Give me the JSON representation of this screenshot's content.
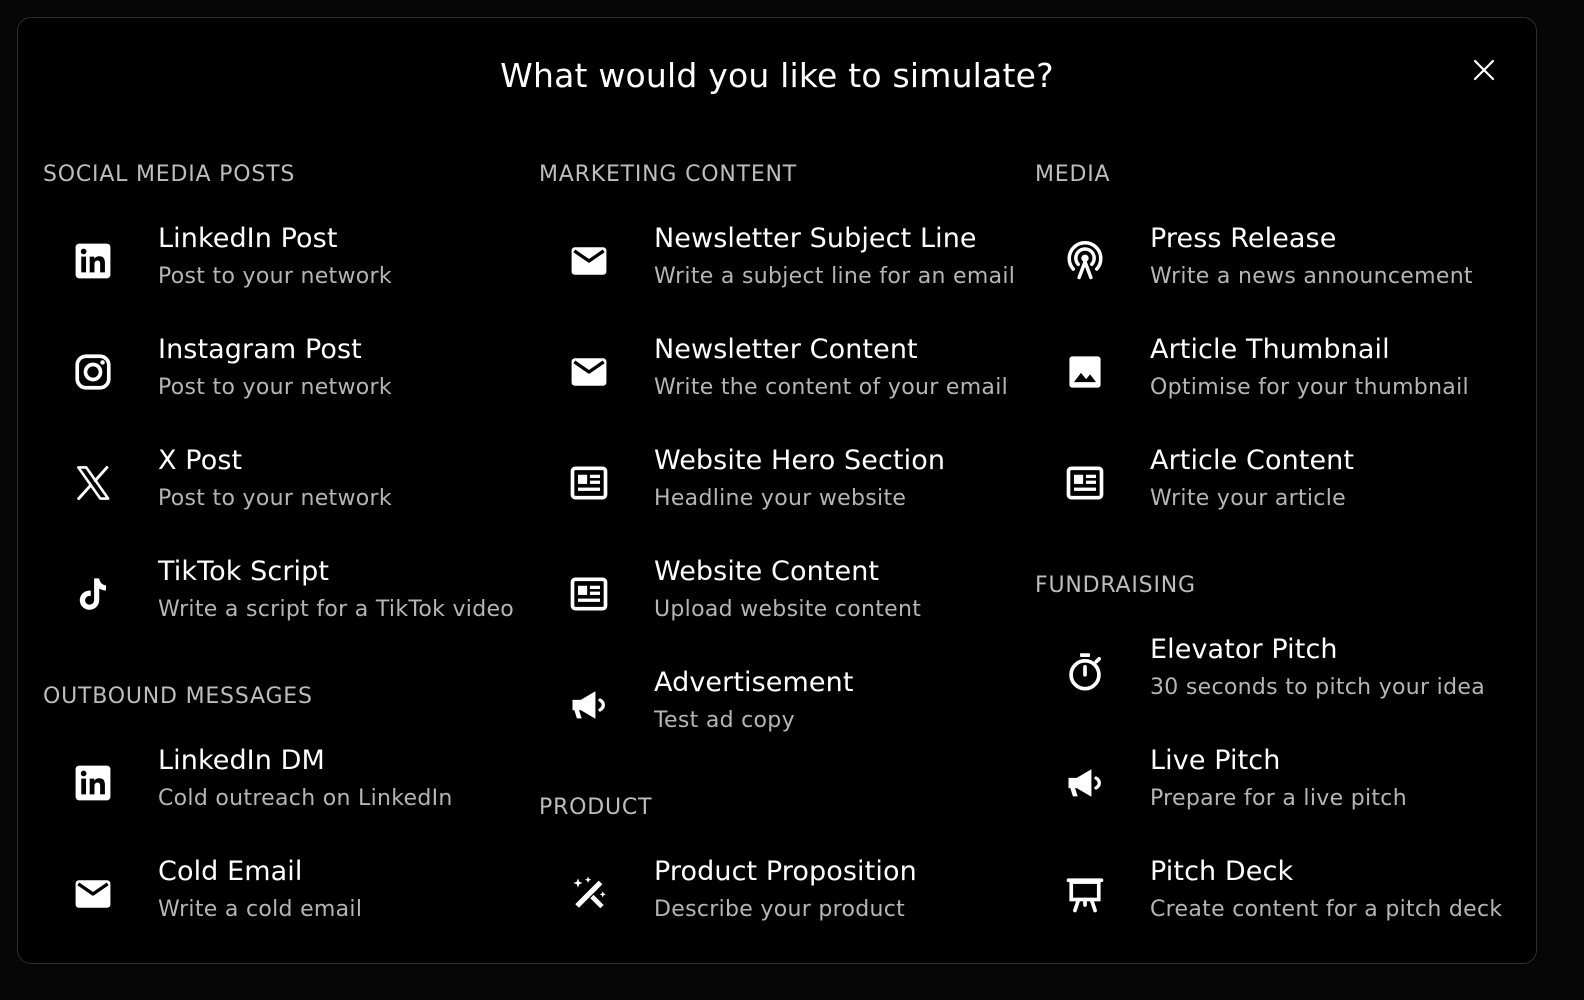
{
  "dialog": {
    "title": "What would you like to simulate?"
  },
  "sections": {
    "social": {
      "title": "SOCIAL MEDIA POSTS",
      "items": [
        {
          "label": "LinkedIn Post",
          "desc": "Post to your network",
          "icon": "linkedin-icon"
        },
        {
          "label": "Instagram Post",
          "desc": "Post to your network",
          "icon": "instagram-icon"
        },
        {
          "label": "X Post",
          "desc": "Post to your network",
          "icon": "x-icon"
        },
        {
          "label": "TikTok Script",
          "desc": "Write a script for a TikTok video",
          "icon": "tiktok-icon"
        }
      ]
    },
    "outbound": {
      "title": "OUTBOUND MESSAGES",
      "items": [
        {
          "label": "LinkedIn DM",
          "desc": "Cold outreach on LinkedIn",
          "icon": "linkedin-icon"
        },
        {
          "label": "Cold Email",
          "desc": "Write a cold email",
          "icon": "email-icon"
        }
      ]
    },
    "marketing": {
      "title": "MARKETING CONTENT",
      "items": [
        {
          "label": "Newsletter Subject Line",
          "desc": "Write a subject line for an email",
          "icon": "email-icon"
        },
        {
          "label": "Newsletter Content",
          "desc": "Write the content of your email",
          "icon": "email-icon"
        },
        {
          "label": "Website Hero Section",
          "desc": "Headline your website",
          "icon": "article-icon"
        },
        {
          "label": "Website Content",
          "desc": "Upload website content",
          "icon": "article-icon"
        },
        {
          "label": "Advertisement",
          "desc": "Test ad copy",
          "icon": "megaphone-icon"
        }
      ]
    },
    "product": {
      "title": "PRODUCT",
      "items": [
        {
          "label": "Product Proposition",
          "desc": "Describe your product",
          "icon": "magic-wand-icon"
        }
      ]
    },
    "media": {
      "title": "MEDIA",
      "items": [
        {
          "label": "Press Release",
          "desc": "Write a news announcement",
          "icon": "broadcast-icon"
        },
        {
          "label": "Article Thumbnail",
          "desc": "Optimise for your thumbnail",
          "icon": "image-icon"
        },
        {
          "label": "Article Content",
          "desc": "Write your article",
          "icon": "article-icon"
        }
      ]
    },
    "fundraising": {
      "title": "FUNDRAISING",
      "items": [
        {
          "label": "Elevator Pitch",
          "desc": "30 seconds to pitch your idea",
          "icon": "timer-icon"
        },
        {
          "label": "Live Pitch",
          "desc": "Prepare for a live pitch",
          "icon": "megaphone-icon"
        },
        {
          "label": "Pitch Deck",
          "desc": "Create content for a pitch deck",
          "icon": "presentation-icon"
        }
      ]
    }
  }
}
